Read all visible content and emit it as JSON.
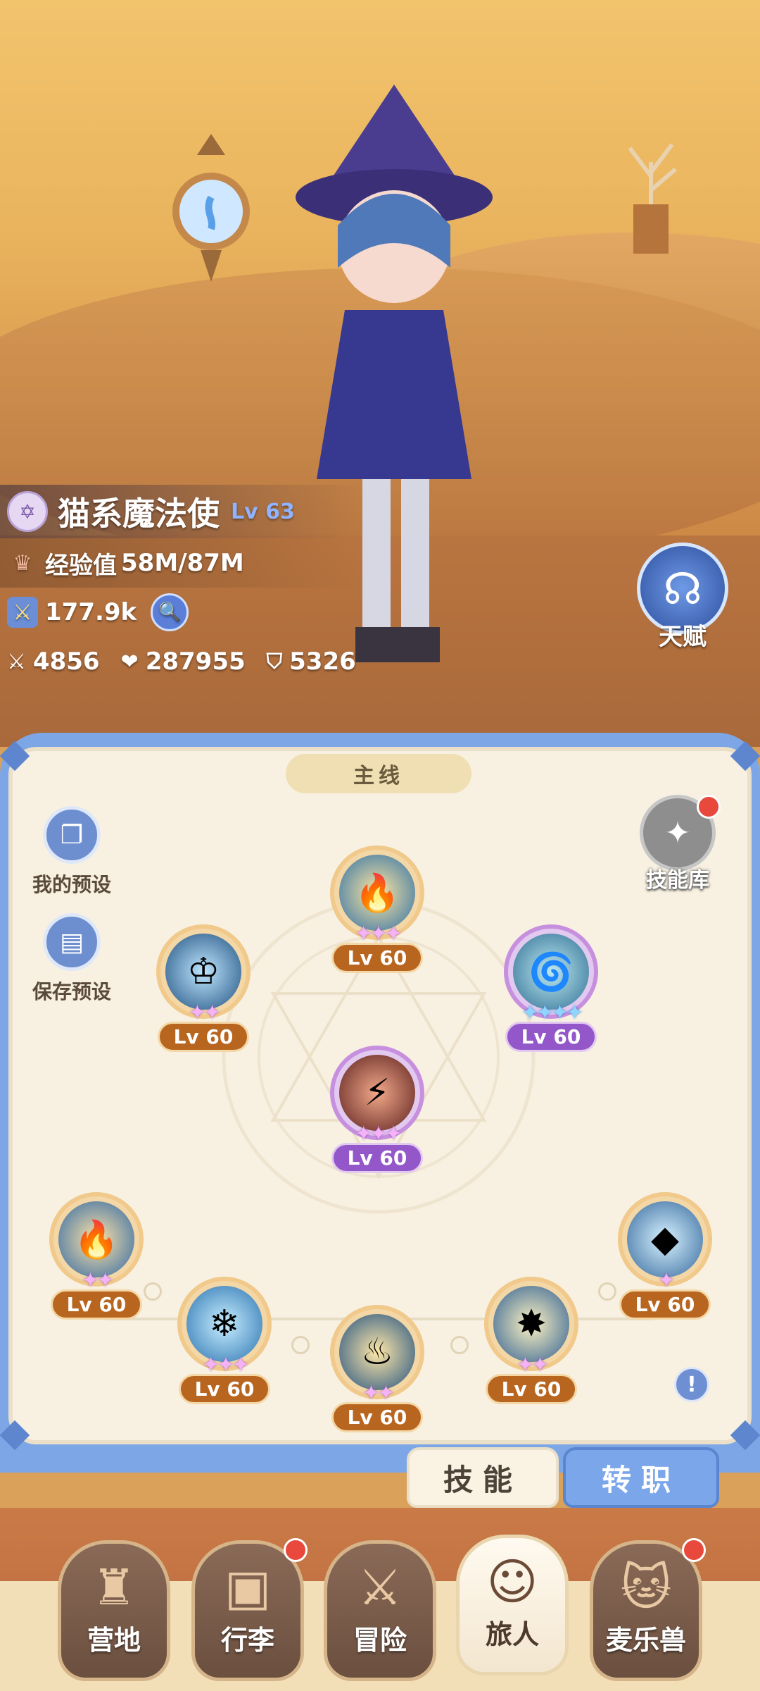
{
  "character": {
    "class_name": "猫系魔法使",
    "level": "Lv 63",
    "exp_label": "经验值",
    "exp_value": "58M/87M",
    "power": "177.9k",
    "attack": "4856",
    "hp": "287955",
    "defense": "5326"
  },
  "talent": {
    "label": "天赋"
  },
  "panel": {
    "section_tag": "主线",
    "my_presets": "我的预设",
    "save_presets": "保存预设",
    "skill_library": "技能库"
  },
  "skills": [
    {
      "id": "top",
      "level": "Lv 60",
      "stars": "✦✦✦",
      "rarity": "orange"
    },
    {
      "id": "left",
      "level": "Lv 60",
      "stars": "✦✦",
      "rarity": "orange"
    },
    {
      "id": "right",
      "level": "Lv 60",
      "stars": "✦✦✦✦",
      "rarity": "purple"
    },
    {
      "id": "center",
      "level": "Lv 60",
      "stars": "✦✦✦",
      "rarity": "purple"
    },
    {
      "id": "b1",
      "level": "Lv 60",
      "stars": "✦✦",
      "rarity": "orange"
    },
    {
      "id": "b2",
      "level": "Lv 60",
      "stars": "✦✦✦",
      "rarity": "orange"
    },
    {
      "id": "b3",
      "level": "Lv 60",
      "stars": "✦✦",
      "rarity": "orange"
    },
    {
      "id": "b4",
      "level": "Lv 60",
      "stars": "✦✦",
      "rarity": "orange"
    },
    {
      "id": "b5",
      "level": "Lv 60",
      "stars": "✦",
      "rarity": "orange"
    }
  ],
  "tabs": {
    "skill": "技能",
    "job": "转职"
  },
  "nav": [
    {
      "label": "营地",
      "icon": "castle-icon",
      "badge": false
    },
    {
      "label": "行李",
      "icon": "backpack-icon",
      "badge": true
    },
    {
      "label": "冒险",
      "icon": "crossed-swords-icon",
      "badge": false
    },
    {
      "label": "旅人",
      "icon": "traveler-portrait-icon",
      "badge": false,
      "active": true
    },
    {
      "label": "麦乐兽",
      "icon": "pet-cat-icon",
      "badge": true
    }
  ],
  "colors": {
    "accent_blue": "#7ca6ea",
    "badge_red": "#e8493c",
    "level_orange": "#b8661f",
    "level_purple": "#9357c9"
  }
}
